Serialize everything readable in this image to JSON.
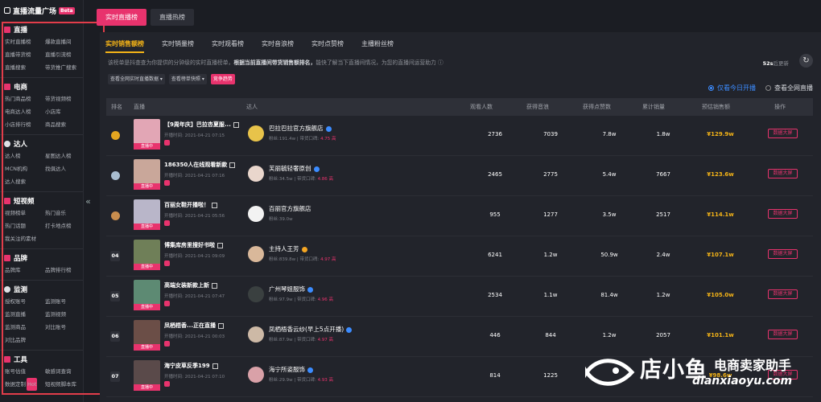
{
  "sidebar": {
    "title": "直播流量广场",
    "beta": "Beta",
    "sections": [
      {
        "title": "直播",
        "items": [
          "实时直播榜",
          "爆款直播间",
          "直播带货榜",
          "直播引流榜",
          "直播搜索",
          "带货推广搜索"
        ]
      },
      {
        "title": "电商",
        "items": [
          "热门商品榜",
          "带货视频榜",
          "电商达人榜",
          "小店库",
          "小店排行榜",
          "商品搜索"
        ]
      },
      {
        "title": "达人",
        "items": [
          "达人榜",
          "星图达人榜",
          "MCN机构",
          "找俱达人",
          "达人搜索"
        ]
      },
      {
        "title": "短视频",
        "items": [
          "视频榜单",
          "热门音乐",
          "热门话题",
          "打卡地点榜",
          "我关注的素材"
        ]
      },
      {
        "title": "品牌",
        "items": [
          "品牌库",
          "品牌排行榜"
        ]
      },
      {
        "title": "监测",
        "items": [
          "授权账号",
          "监测账号",
          "监测直播",
          "监测视频",
          "监测商品",
          "对比账号",
          "对比品牌"
        ]
      },
      {
        "title": "工具",
        "items": [
          "账号估值",
          "敏感词查询",
          "数据定制",
          "短视频脚本库"
        ]
      }
    ],
    "hot_badge": "Hot",
    "collapse_icon": "«"
  },
  "top_tabs": [
    "实时直播榜",
    "直播热榜"
  ],
  "sub_tabs": [
    "实时销售额榜",
    "实时销量榜",
    "实时观看榜",
    "实时音浪榜",
    "实时点赞榜",
    "主播粉丝榜"
  ],
  "description": {
    "part1": "该榜单是抖查查为你提供的分钟级的实时直播榜单，",
    "bold": "根据当前直播间带货销售额排名，",
    "part2": "能快了解当下直播间情况，为您的直播间运营助力 ⓘ"
  },
  "refresh": {
    "seconds": "52s",
    "suffix": "后更新",
    "icon": "↻"
  },
  "filters": [
    "查看全网实时直播数据 ▾",
    "查看榜单快照 ▾",
    "竞争趋势"
  ],
  "radios": [
    {
      "label": "仅看今日开播",
      "checked": true
    },
    {
      "label": "查看全网直播",
      "checked": false
    }
  ],
  "columns": [
    "排名",
    "直播",
    "达人",
    "观看人数",
    "获得音浪",
    "获得点赞数",
    "累计销量",
    "预估销售额",
    "操作"
  ],
  "live_badge": "直播中",
  "action_label": "数据大屏",
  "rows": [
    {
      "rank": "1",
      "title": "【9周年庆】巴拉杏夏服...",
      "time": "开播时间: 2021-04-21 07:15",
      "name": "巴拉巴拉官方旗舰店",
      "fans": "粉丝:191.4w | 带货口碑: ",
      "score": "4.75 高",
      "views": "2736",
      "yin": "7039",
      "likes": "7.8w",
      "sales": "1.8w",
      "amount": "¥129.9w",
      "color": "#e2a6b5",
      "avatar": "#e8c34a",
      "vf": "b"
    },
    {
      "rank": "2",
      "title": "186350人在线观看新款",
      "time": "开播时间: 2021-04-21 07:16",
      "name": "芙丽毓轻奢原创",
      "fans": "粉丝:34.5w | 带货口碑: ",
      "score": "4.86 高",
      "views": "2465",
      "yin": "2775",
      "likes": "5.4w",
      "sales": "7667",
      "amount": "¥123.6w",
      "color": "#c9a79a",
      "avatar": "#e9d6cc",
      "vf": "b"
    },
    {
      "rank": "3",
      "title": "百丽女鞋开播啦！",
      "time": "开播时间: 2021-04-21 05:56",
      "name": "百丽官方旗舰店",
      "fans": "粉丝:39.0w",
      "score": "",
      "views": "955",
      "yin": "1277",
      "likes": "3.5w",
      "sales": "2517",
      "amount": "¥114.1w",
      "color": "#b9b6c9",
      "avatar": "#f2f2f2",
      "vf": ""
    },
    {
      "rank": "04",
      "title": "博集库房里搜好书啦",
      "time": "开播时间: 2021-04-21 09:09",
      "name": "主持人王芳",
      "fans": "粉丝:839.8w | 带货口碑: ",
      "score": "4.97 高",
      "views": "6241",
      "yin": "1.2w",
      "likes": "50.9w",
      "sales": "2.4w",
      "amount": "¥107.1w",
      "color": "#6f7f58",
      "avatar": "#d9b89a",
      "vf": "o"
    },
    {
      "rank": "05",
      "title": "高端女装新款上新",
      "time": "开播时间: 2021-04-21 07:47",
      "name": "广州琴姐服饰",
      "fans": "粉丝:97.9w | 带货口碑: ",
      "score": "4.96 高",
      "views": "2534",
      "yin": "1.1w",
      "likes": "81.4w",
      "sales": "1.2w",
      "amount": "¥105.0w",
      "color": "#5d8a73",
      "avatar": "#3a4040",
      "vf": "b"
    },
    {
      "rank": "06",
      "title": "凤栖梧香...正在直播",
      "time": "开播时间: 2021-04-21 00:03",
      "name": "凤栖梧香云纱(早上5点开播)",
      "fans": "粉丝:87.9w | 带货口碑: ",
      "score": "4.97 高",
      "views": "446",
      "yin": "844",
      "likes": "1.2w",
      "sales": "2057",
      "amount": "¥101.1w",
      "color": "#6b4e47",
      "avatar": "#cdb9a6",
      "vf": "b"
    },
    {
      "rank": "07",
      "title": "海宁皮草反季199",
      "time": "开播时间: 2021-04-21 07:10",
      "name": "海宁所姿服饰",
      "fans": "粉丝:29.9w | 带货口碑: ",
      "score": "4.93 高",
      "views": "814",
      "yin": "1225",
      "likes": "",
      "sales": "",
      "amount": "¥98.6w",
      "color": "#5a4a4a",
      "avatar": "#d9a1a8",
      "vf": "b"
    }
  ],
  "watermark": {
    "brand": "店小鱼",
    "tagline": "电商卖家助手",
    "domain": "dianxiaoyu.com"
  }
}
